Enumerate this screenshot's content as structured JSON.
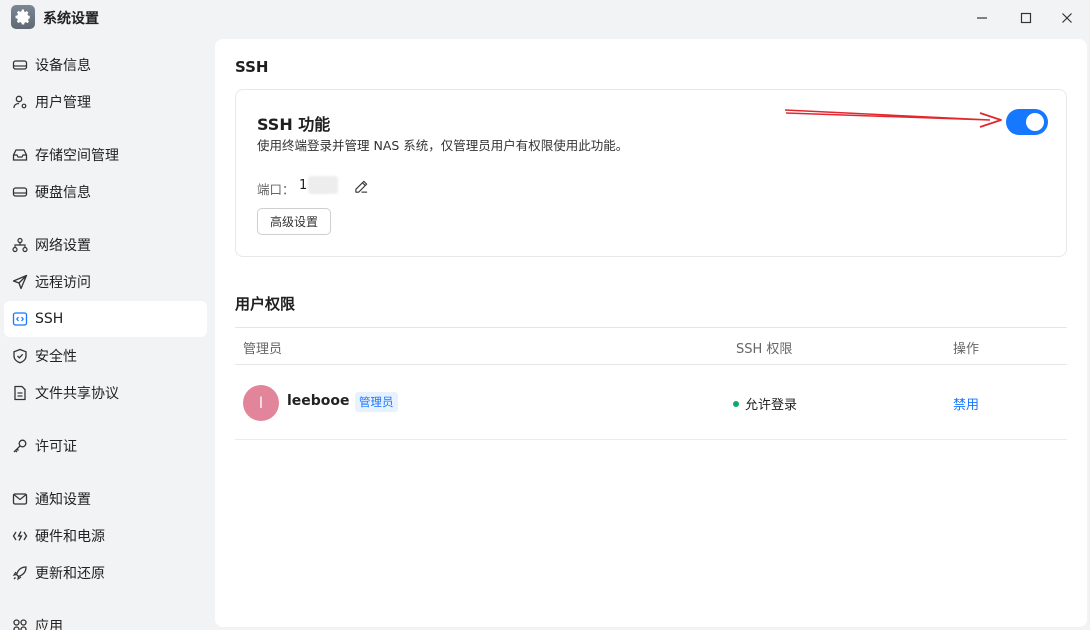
{
  "window": {
    "title": "系统设置",
    "app_icon": "gear-icon",
    "controls": [
      "minimize-icon",
      "maximize-icon",
      "close-icon"
    ]
  },
  "sidebar": {
    "items": [
      {
        "label": "设备信息",
        "icon": "drive-icon"
      },
      {
        "label": "用户管理",
        "icon": "users-icon"
      },
      {
        "label": "存储空间管理",
        "icon": "storage-icon"
      },
      {
        "label": "硬盘信息",
        "icon": "disk-icon"
      },
      {
        "label": "网络设置",
        "icon": "network-icon"
      },
      {
        "label": "远程访问",
        "icon": "send-icon"
      },
      {
        "label": "SSH",
        "icon": "code-icon",
        "active": true
      },
      {
        "label": "安全性",
        "icon": "shield-icon"
      },
      {
        "label": "文件共享协议",
        "icon": "document-icon"
      },
      {
        "label": "许可证",
        "icon": "key-icon"
      },
      {
        "label": "通知设置",
        "icon": "mail-icon"
      },
      {
        "label": "硬件和电源",
        "icon": "power-icon"
      },
      {
        "label": "更新和还原",
        "icon": "rocket-icon"
      },
      {
        "label": "应用",
        "icon": "apps-icon"
      }
    ]
  },
  "main": {
    "section_title": "SSH",
    "ssh_card": {
      "title": "SSH 功能",
      "description": "使用终端登录并管理 NAS 系统，仅管理员用户有权限使用此功能。",
      "port_label": "端口：",
      "port_value": "1",
      "advanced_button": "高级设置",
      "enabled": true
    },
    "permissions": {
      "title": "用户权限",
      "columns": [
        "管理员",
        "SSH 权限",
        "操作"
      ],
      "rows": [
        {
          "avatar_letter": "l",
          "name": "leebooe",
          "role": "管理员",
          "ssh_status": "允许登录",
          "action": "禁用"
        }
      ]
    }
  },
  "colors": {
    "accent": "#1677ff",
    "avatar": "#e2849a",
    "status_ok": "#0fa968",
    "annotation_arrow": "#e0282e"
  }
}
